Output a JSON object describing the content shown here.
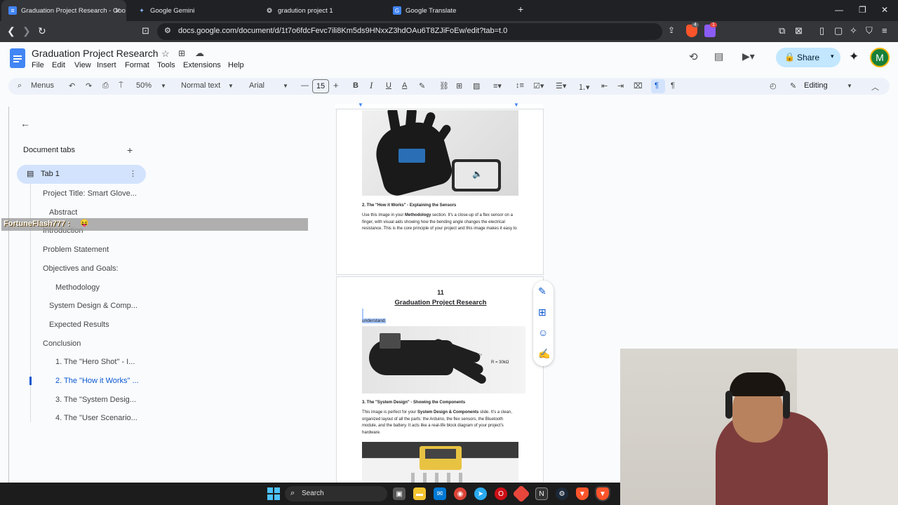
{
  "browser": {
    "tabs": [
      {
        "title": "Graduation Project Research - Goo",
        "icon": "docs-icon",
        "active": true
      },
      {
        "title": "Google Gemini",
        "icon": "gemini-icon",
        "active": false
      },
      {
        "title": "gradution project 1",
        "icon": "chatgpt-icon",
        "active": false
      },
      {
        "title": "Google Translate",
        "icon": "translate-icon",
        "active": false
      }
    ],
    "url": "docs.google.com/document/d/1t7o6fdcFevc7ili8Km5ds9HNxxZ3hdOAu6T8ZJiFoEw/edit?tab=t.0",
    "brave_badge": "4",
    "rewards_badge": "1"
  },
  "docs": {
    "title": "Graduation Project Research",
    "menus": [
      "File",
      "Edit",
      "View",
      "Insert",
      "Format",
      "Tools",
      "Extensions",
      "Help"
    ],
    "share_label": "Share",
    "avatar_letter": "M",
    "toolbar": {
      "menus_label": "Menus",
      "zoom": "50%",
      "style": "Normal text",
      "font": "Arial",
      "font_size": "15",
      "mode": "Editing"
    }
  },
  "sidebar": {
    "header": "Document tabs",
    "tab_name": "Tab 1",
    "outline": [
      "Project Title: Smart Glove...",
      "Abstract",
      "Introduction",
      "Problem Statement",
      "Objectives and Goals:",
      "Methodology",
      "System Design & Comp...",
      "Expected Results",
      "Conclusion",
      "1. The \"Hero Shot\" - I...",
      "2. The \"How it Works\" ...",
      "3. The \"System Desig...",
      "4. The \"User Scenario..."
    ]
  },
  "overlay": {
    "chat_text": "FortuneFlash777 :"
  },
  "page1": {
    "heading": "2. The \"How it Works\" - Explaining the Sensors",
    "para_start": "Use this image in your ",
    "para_bold": "Methodology",
    "para_end": " section. It's a close-up of a flex sensor on a finger, with visual aids showing how the bending angle changes the electrical resistance. This is the core principle of your project and this image makes it easy to"
  },
  "page2": {
    "page_number": "11",
    "header_title": "Graduation Project Research",
    "selected_word": "understand.",
    "image_label_angle": "45°",
    "image_label_res": "R = 30kΩ",
    "heading": "3. The \"System Design\" - Showing the Components",
    "para_start": "This image is perfect for your ",
    "para_bold": "System Design & Components",
    "para_end": " slide. It's a clean, organized layout of all the parts: the Arduino, the flex sensors, the Bluetooth module, and the battery. It acts like a real-life block diagram of your project's hardware."
  },
  "taskbar": {
    "search_label": "Search"
  },
  "colors": {
    "accent": "#0b57d0",
    "share_bg": "#c2e7ff",
    "tab_selected": "#d3e3fd",
    "avatar": "#188038"
  }
}
